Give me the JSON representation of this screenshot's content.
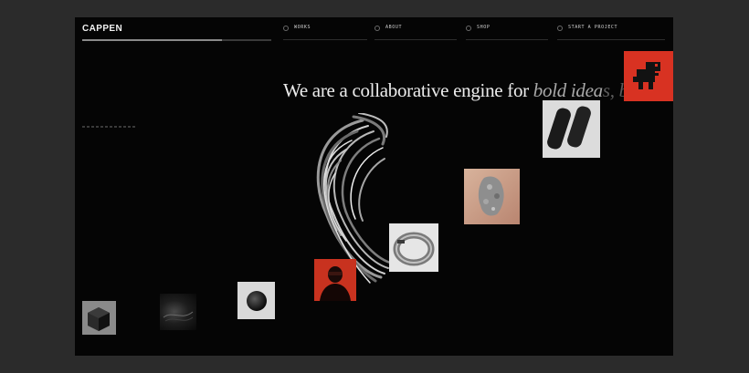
{
  "brand": {
    "logo": "CAPPEN",
    "progress": 0.74
  },
  "nav": [
    {
      "label": "WORKS"
    },
    {
      "label": "ABOUT"
    },
    {
      "label": "SHOP"
    },
    {
      "label": "START A PROJECT"
    }
  ],
  "hero": {
    "headline_main": "We are a collaborative engine for ",
    "headline_italic": "bold idea",
    "headline_fade": "s, beautiful"
  },
  "tiles": [
    {
      "name": "cube-tile",
      "color": "#8a8a8a"
    },
    {
      "name": "dark-texture-tile",
      "color": "#1e1e1e"
    },
    {
      "name": "sphere-tile",
      "color": "#d9d9d9"
    },
    {
      "name": "red-figure-tile",
      "color": "#c8321f"
    },
    {
      "name": "metal-ring-tile",
      "color": "#e6e6e6"
    },
    {
      "name": "coral-stone-tile",
      "color": "#c9a08a"
    },
    {
      "name": "text-slabs-tile",
      "color": "#dcdcdc"
    },
    {
      "name": "pixel-dino-tile",
      "color": "#d83222"
    }
  ]
}
